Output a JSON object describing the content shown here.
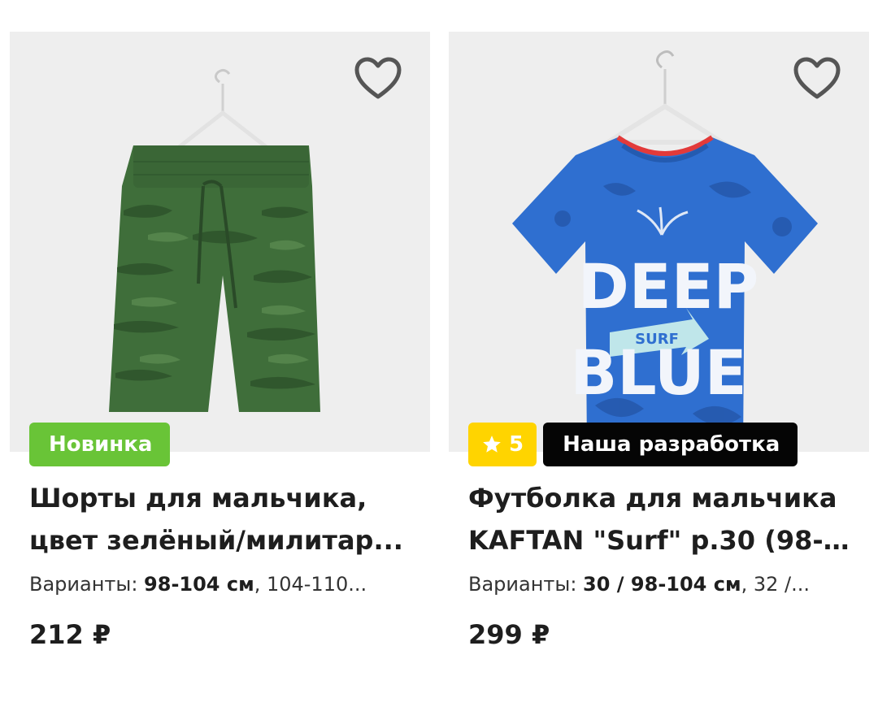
{
  "products": [
    {
      "title_line1": "Шорты для мальчика,",
      "title_line2": "цвет зелёный/милитар...",
      "badge_new": "Новинка",
      "variants_label": "Варианты:",
      "variants_selected": "98-104 см",
      "variants_rest": ", 104-110...",
      "price": "212 ₽",
      "image_icon": "camo-shorts-image",
      "favorite_icon": "heart-outline-icon"
    },
    {
      "title_line1": "Футболка для мальчика",
      "title_line2": "KAFTAN \"Surf\" р.30 (98-1...",
      "rating": "5",
      "badge_brand": "Наша разработка",
      "variants_label": "Варианты:",
      "variants_selected": "30 / 98-104 см",
      "variants_rest": ", 32 /...",
      "price": "299 ₽",
      "image_icon": "blue-tshirt-image",
      "favorite_icon": "heart-outline-icon",
      "print_text": [
        "DEEP",
        "SURF",
        "BLUE"
      ]
    }
  ],
  "colors": {
    "photo_bg": "#eeeeee",
    "badge_new": "#69c437",
    "badge_rating": "#ffd400",
    "badge_brand": "#050505",
    "text": "#1e1e1e"
  }
}
